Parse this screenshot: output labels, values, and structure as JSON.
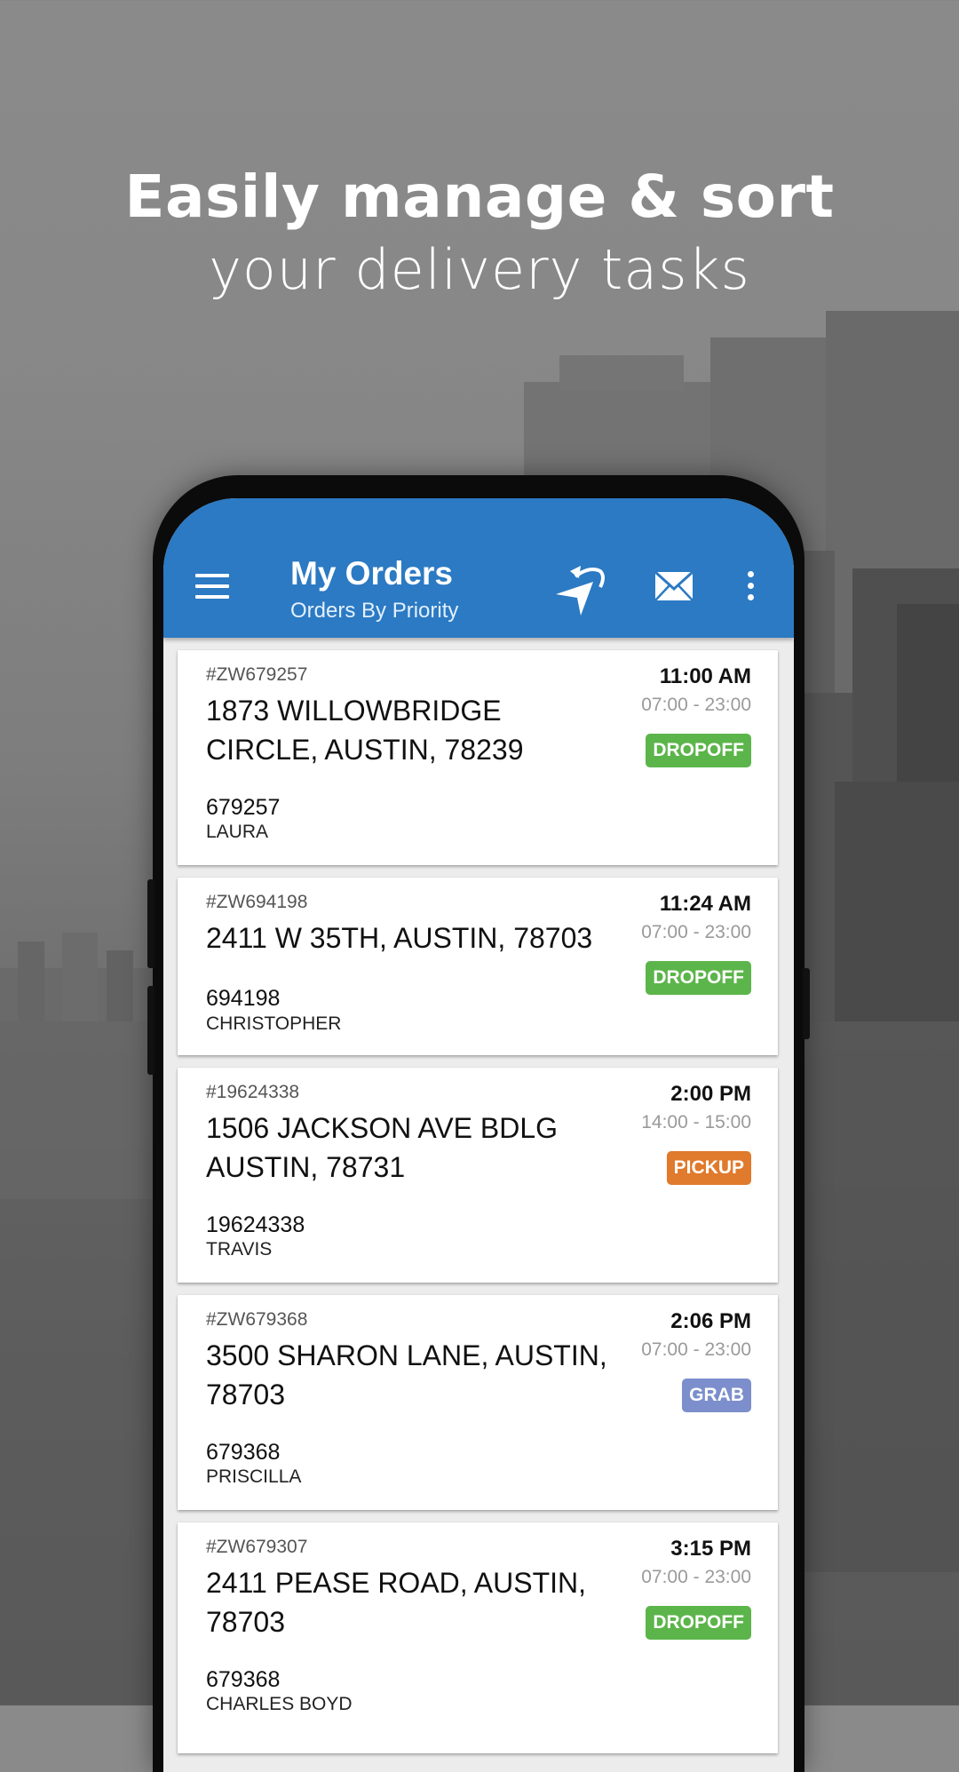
{
  "headline": {
    "line1": "Easily manage & sort",
    "line2": "your delivery tasks"
  },
  "appbar": {
    "title": "My Orders",
    "subtitle": "Orders By Priority",
    "icons": [
      "menu-icon",
      "navigation-arrow-icon",
      "mail-icon",
      "more-vert-icon"
    ]
  },
  "colors": {
    "appbar": "#2b7ac3",
    "dropoff": "#5cb54a",
    "pickup": "#e07a2c",
    "grab": "#7c8fcc"
  },
  "orders": [
    {
      "id": "#ZW679257",
      "address": "1873  WILLOWBRIDGE CIRCLE, AUSTIN, 78239",
      "number": "679257",
      "name": "LAURA",
      "time": "11:00 AM",
      "window": "07:00 - 23:00",
      "type": "DROPOFF"
    },
    {
      "id": "#ZW694198",
      "address": "2411 W 35TH, AUSTIN, 78703",
      "number": "694198",
      "name": "CHRISTOPHER",
      "time": "11:24 AM",
      "window": "07:00 - 23:00",
      "type": "DROPOFF"
    },
    {
      "id": "#19624338",
      "address": "1506 JACKSON AVE BDLG AUSTIN, 78731",
      "number": "19624338",
      "name": "TRAVIS",
      "time": "2:00 PM",
      "window": "14:00 - 15:00",
      "type": "PICKUP"
    },
    {
      "id": "#ZW679368",
      "address": "3500 SHARON LANE, AUSTIN, 78703",
      "number": "679368",
      "name": "PRISCILLA",
      "time": "2:06 PM",
      "window": "07:00 - 23:00",
      "type": "GRAB"
    },
    {
      "id": "#ZW679307",
      "address": "2411 PEASE ROAD, AUSTIN, 78703",
      "number": "679368",
      "name": "CHARLES BOYD",
      "time": "3:15 PM",
      "window": "07:00 - 23:00",
      "type": "DROPOFF"
    }
  ]
}
